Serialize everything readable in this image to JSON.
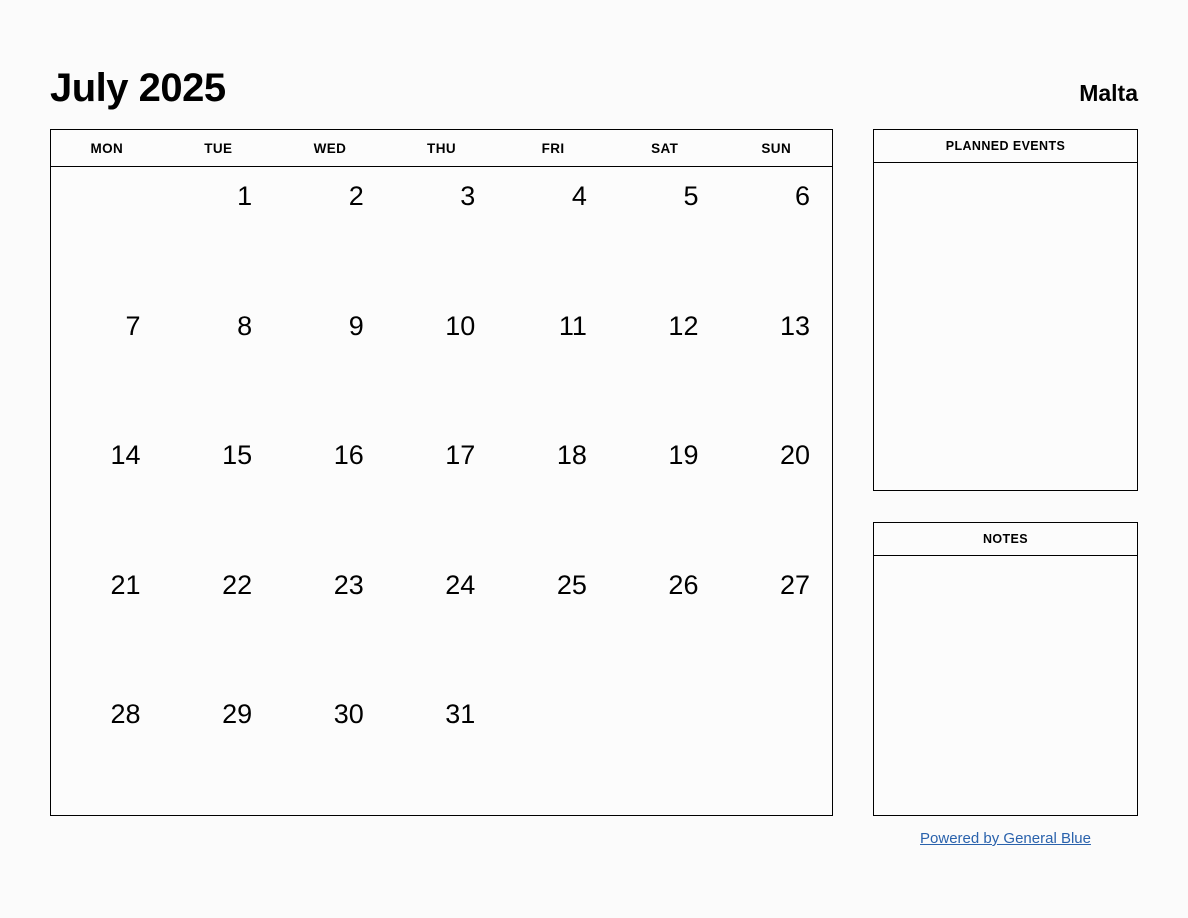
{
  "header": {
    "month_title": "July 2025",
    "locale": "Malta"
  },
  "calendar": {
    "weekdays": [
      "MON",
      "TUE",
      "WED",
      "THU",
      "FRI",
      "SAT",
      "SUN"
    ],
    "weeks": [
      [
        "",
        "1",
        "2",
        "3",
        "4",
        "5",
        "6"
      ],
      [
        "7",
        "8",
        "9",
        "10",
        "11",
        "12",
        "13"
      ],
      [
        "14",
        "15",
        "16",
        "17",
        "18",
        "19",
        "20"
      ],
      [
        "21",
        "22",
        "23",
        "24",
        "25",
        "26",
        "27"
      ],
      [
        "28",
        "29",
        "30",
        "31",
        "",
        "",
        ""
      ]
    ]
  },
  "sidebar": {
    "planned_events": {
      "title": "PLANNED EVENTS",
      "content": ""
    },
    "notes": {
      "title": "NOTES",
      "content": ""
    }
  },
  "footer": {
    "link_label": "Powered by General Blue"
  },
  "colors": {
    "page_background": "#fbfbfb",
    "border": "#000000",
    "text": "#000000",
    "link": "#2a62ac"
  }
}
